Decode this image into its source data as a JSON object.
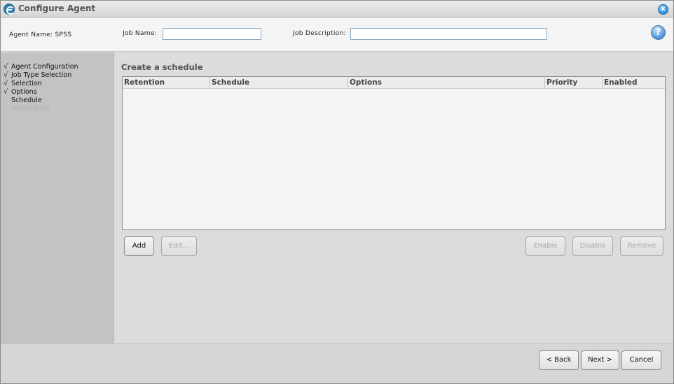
{
  "window": {
    "title": "Configure Agent",
    "close_glyph": "x"
  },
  "header": {
    "agent_name": "Agent Name: SPSS",
    "job_name_label": "Job Name:",
    "job_name_value": "",
    "job_description_label": "Job Description:",
    "job_description_value": "",
    "help_glyph": "?"
  },
  "sidebar": {
    "steps": [
      {
        "label": "Agent Configuration",
        "check": "√"
      },
      {
        "label": "Job Type Selection",
        "check": "√"
      },
      {
        "label": "Selection",
        "check": "√"
      },
      {
        "label": "Options",
        "check": "√"
      },
      {
        "label": "Schedule",
        "check": ""
      },
      {
        "label": "Destination",
        "check": ""
      }
    ]
  },
  "main": {
    "section_title": "Create a schedule",
    "table": {
      "columns": [
        "Retention",
        "Schedule",
        "Options",
        "Priority",
        "Enabled"
      ],
      "rows": []
    },
    "buttons": {
      "add": "Add",
      "edit": "Edit...",
      "enable": "Enable",
      "disable": "Disable",
      "remove": "Remove"
    }
  },
  "footer": {
    "back": "< Back",
    "next": "Next >",
    "cancel": "Cancel"
  },
  "colors": {
    "sidebar_bg": "#c3c3c3",
    "content_bg": "#dcdcdc",
    "accent": "#2e7fb0"
  }
}
